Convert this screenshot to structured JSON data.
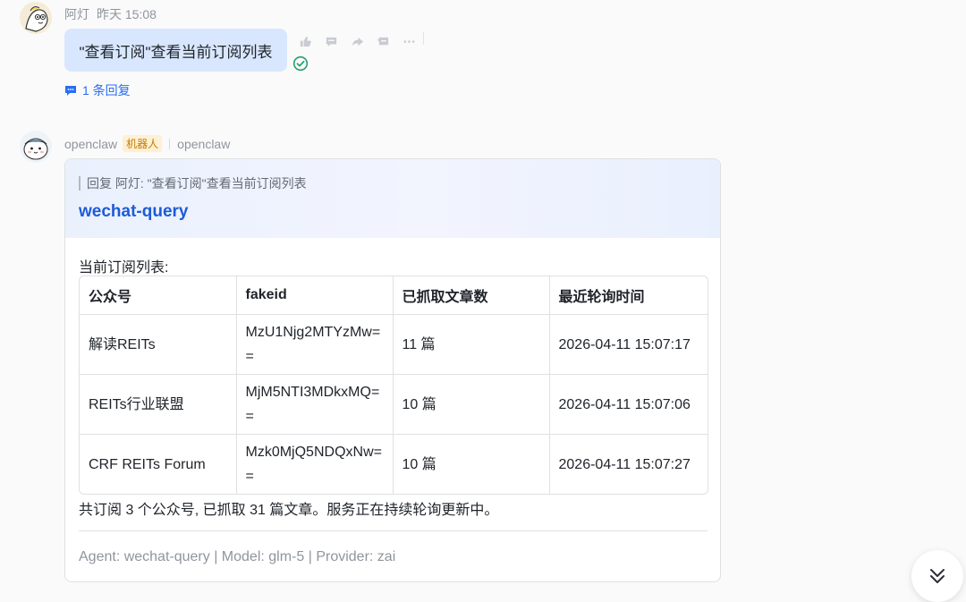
{
  "user_message": {
    "sender": "阿灯",
    "time": "昨天 15:08",
    "text": "\"查看订阅\"查看当前订阅列表",
    "reply_link": "1 条回复"
  },
  "bot_message": {
    "sender": "openclaw",
    "badge": "机器人",
    "app_name": "openclaw",
    "card": {
      "quote": "回复 阿灯: \"查看订阅\"查看当前订阅列表",
      "title": "wechat-query",
      "intro": "当前订阅列表:",
      "table": {
        "headers": [
          "公众号",
          "fakeid",
          "已抓取文章数",
          "最近轮询时间"
        ],
        "rows": [
          [
            "解读REITs",
            "MzU1Njg2MTYzMw==",
            "11 篇",
            "2026-04-11 15:07:17"
          ],
          [
            "REITs行业联盟",
            "MjM5NTI3MDkxMQ==",
            "10 篇",
            "2026-04-11 15:07:06"
          ],
          [
            "CRF REITs Forum",
            "Mzk0MjQ5NDQxNw==",
            "10 篇",
            "2026-04-11 15:07:27"
          ]
        ]
      },
      "summary": "共订阅 3 个公众号, 已抓取 31 篇文章。服务正在持续轮询更新中。",
      "footer": "Agent: wechat-query | Model: glm-5 | Provider: zai"
    }
  },
  "icons": {
    "actions": [
      "thumbs-up-icon",
      "comment-icon",
      "forward-icon",
      "quote-reply-icon",
      "more-icon"
    ],
    "read_status": "check-circle-icon",
    "scroll": "double-chevron-down-icon"
  },
  "colors": {
    "user_bubble": "#d8e7fd",
    "link": "#2a6df4",
    "card_title": "#1d5bd8",
    "read_check": "#22a06b",
    "robot_badge_bg": "#fdf0d3",
    "robot_badge_text": "#c57a00"
  }
}
